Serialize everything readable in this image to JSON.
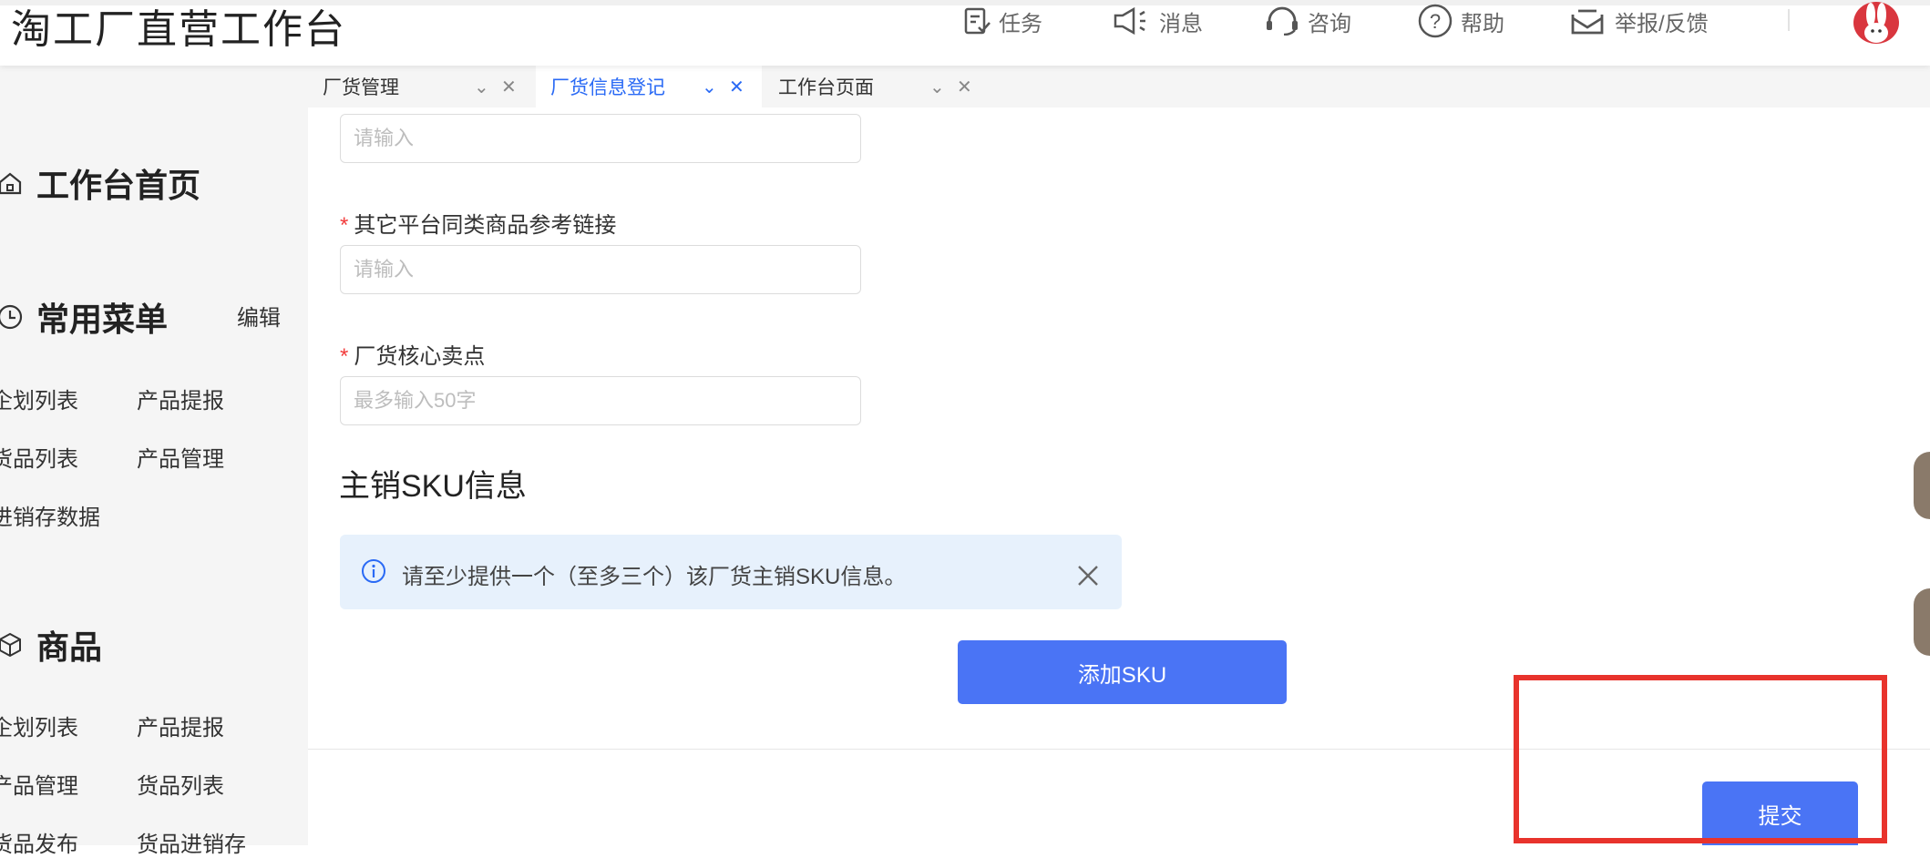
{
  "header": {
    "title": "淘工厂直营工作台",
    "items": [
      {
        "icon": "task-icon",
        "label": "任务"
      },
      {
        "icon": "megaphone-icon",
        "label": "消息"
      },
      {
        "icon": "headset-icon",
        "label": "咨询"
      },
      {
        "icon": "help-circle-icon",
        "label": "帮助"
      },
      {
        "icon": "envelope-icon",
        "label": "举报/反馈"
      }
    ]
  },
  "sidebar": {
    "home": {
      "icon": "home-icon",
      "label": "工作台首页"
    },
    "common_menu": {
      "icon": "clock-icon",
      "label": "常用菜单",
      "edit_label": "编辑",
      "items": [
        "企划列表",
        "产品提报",
        "货品列表",
        "产品管理",
        "进销存数据"
      ]
    },
    "goods": {
      "icon": "cube-icon",
      "label": "商品",
      "items": [
        "企划列表",
        "产品提报",
        "产品管理",
        "货品列表",
        "货品发布",
        "货品进销存"
      ]
    }
  },
  "tabs": [
    {
      "label": "厂货管理",
      "active": false
    },
    {
      "label": "厂货信息登记",
      "active": true
    },
    {
      "label": "工作台页面",
      "active": false
    }
  ],
  "form": {
    "field1": {
      "placeholder": "请输入",
      "value": ""
    },
    "field2": {
      "label": "其它平台同类商品参考链接",
      "placeholder": "请输入",
      "value": ""
    },
    "field3": {
      "label": "厂货核心卖点",
      "placeholder": "最多输入50字",
      "value": ""
    },
    "sku_section_title": "主销SKU信息",
    "sku_notice": "请至少提供一个（至多三个）该厂货主销SKU信息。",
    "add_sku_label": "添加SKU",
    "submit_label": "提交"
  },
  "colors": {
    "primary": "#4a74f5",
    "active_tab": "#2a6af5",
    "required": "#f23c3c",
    "notice_bg": "#e7f1fc",
    "highlight": "#e8332c"
  }
}
